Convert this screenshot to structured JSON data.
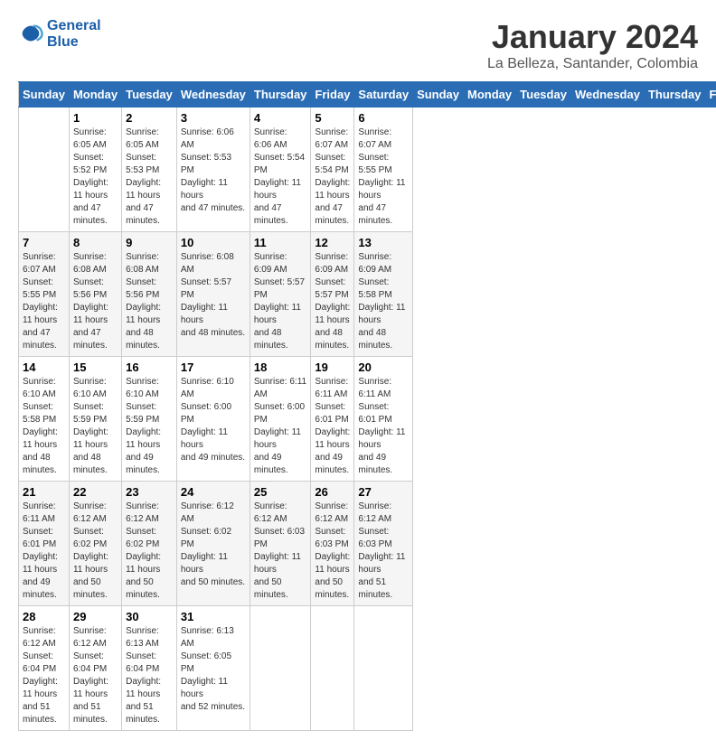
{
  "header": {
    "logo_line1": "General",
    "logo_line2": "Blue",
    "title": "January 2024",
    "subtitle": "La Belleza, Santander, Colombia"
  },
  "days_of_week": [
    "Sunday",
    "Monday",
    "Tuesday",
    "Wednesday",
    "Thursday",
    "Friday",
    "Saturday"
  ],
  "weeks": [
    [
      {
        "day": "",
        "info": ""
      },
      {
        "day": "1",
        "info": "Sunrise: 6:05 AM\nSunset: 5:52 PM\nDaylight: 11 hours\nand 47 minutes."
      },
      {
        "day": "2",
        "info": "Sunrise: 6:05 AM\nSunset: 5:53 PM\nDaylight: 11 hours\nand 47 minutes."
      },
      {
        "day": "3",
        "info": "Sunrise: 6:06 AM\nSunset: 5:53 PM\nDaylight: 11 hours\nand 47 minutes."
      },
      {
        "day": "4",
        "info": "Sunrise: 6:06 AM\nSunset: 5:54 PM\nDaylight: 11 hours\nand 47 minutes."
      },
      {
        "day": "5",
        "info": "Sunrise: 6:07 AM\nSunset: 5:54 PM\nDaylight: 11 hours\nand 47 minutes."
      },
      {
        "day": "6",
        "info": "Sunrise: 6:07 AM\nSunset: 5:55 PM\nDaylight: 11 hours\nand 47 minutes."
      }
    ],
    [
      {
        "day": "7",
        "info": "Sunrise: 6:07 AM\nSunset: 5:55 PM\nDaylight: 11 hours\nand 47 minutes."
      },
      {
        "day": "8",
        "info": "Sunrise: 6:08 AM\nSunset: 5:56 PM\nDaylight: 11 hours\nand 47 minutes."
      },
      {
        "day": "9",
        "info": "Sunrise: 6:08 AM\nSunset: 5:56 PM\nDaylight: 11 hours\nand 48 minutes."
      },
      {
        "day": "10",
        "info": "Sunrise: 6:08 AM\nSunset: 5:57 PM\nDaylight: 11 hours\nand 48 minutes."
      },
      {
        "day": "11",
        "info": "Sunrise: 6:09 AM\nSunset: 5:57 PM\nDaylight: 11 hours\nand 48 minutes."
      },
      {
        "day": "12",
        "info": "Sunrise: 6:09 AM\nSunset: 5:57 PM\nDaylight: 11 hours\nand 48 minutes."
      },
      {
        "day": "13",
        "info": "Sunrise: 6:09 AM\nSunset: 5:58 PM\nDaylight: 11 hours\nand 48 minutes."
      }
    ],
    [
      {
        "day": "14",
        "info": "Sunrise: 6:10 AM\nSunset: 5:58 PM\nDaylight: 11 hours\nand 48 minutes."
      },
      {
        "day": "15",
        "info": "Sunrise: 6:10 AM\nSunset: 5:59 PM\nDaylight: 11 hours\nand 48 minutes."
      },
      {
        "day": "16",
        "info": "Sunrise: 6:10 AM\nSunset: 5:59 PM\nDaylight: 11 hours\nand 49 minutes."
      },
      {
        "day": "17",
        "info": "Sunrise: 6:10 AM\nSunset: 6:00 PM\nDaylight: 11 hours\nand 49 minutes."
      },
      {
        "day": "18",
        "info": "Sunrise: 6:11 AM\nSunset: 6:00 PM\nDaylight: 11 hours\nand 49 minutes."
      },
      {
        "day": "19",
        "info": "Sunrise: 6:11 AM\nSunset: 6:01 PM\nDaylight: 11 hours\nand 49 minutes."
      },
      {
        "day": "20",
        "info": "Sunrise: 6:11 AM\nSunset: 6:01 PM\nDaylight: 11 hours\nand 49 minutes."
      }
    ],
    [
      {
        "day": "21",
        "info": "Sunrise: 6:11 AM\nSunset: 6:01 PM\nDaylight: 11 hours\nand 49 minutes."
      },
      {
        "day": "22",
        "info": "Sunrise: 6:12 AM\nSunset: 6:02 PM\nDaylight: 11 hours\nand 50 minutes."
      },
      {
        "day": "23",
        "info": "Sunrise: 6:12 AM\nSunset: 6:02 PM\nDaylight: 11 hours\nand 50 minutes."
      },
      {
        "day": "24",
        "info": "Sunrise: 6:12 AM\nSunset: 6:02 PM\nDaylight: 11 hours\nand 50 minutes."
      },
      {
        "day": "25",
        "info": "Sunrise: 6:12 AM\nSunset: 6:03 PM\nDaylight: 11 hours\nand 50 minutes."
      },
      {
        "day": "26",
        "info": "Sunrise: 6:12 AM\nSunset: 6:03 PM\nDaylight: 11 hours\nand 50 minutes."
      },
      {
        "day": "27",
        "info": "Sunrise: 6:12 AM\nSunset: 6:03 PM\nDaylight: 11 hours\nand 51 minutes."
      }
    ],
    [
      {
        "day": "28",
        "info": "Sunrise: 6:12 AM\nSunset: 6:04 PM\nDaylight: 11 hours\nand 51 minutes."
      },
      {
        "day": "29",
        "info": "Sunrise: 6:12 AM\nSunset: 6:04 PM\nDaylight: 11 hours\nand 51 minutes."
      },
      {
        "day": "30",
        "info": "Sunrise: 6:13 AM\nSunset: 6:04 PM\nDaylight: 11 hours\nand 51 minutes."
      },
      {
        "day": "31",
        "info": "Sunrise: 6:13 AM\nSunset: 6:05 PM\nDaylight: 11 hours\nand 52 minutes."
      },
      {
        "day": "",
        "info": ""
      },
      {
        "day": "",
        "info": ""
      },
      {
        "day": "",
        "info": ""
      }
    ]
  ]
}
